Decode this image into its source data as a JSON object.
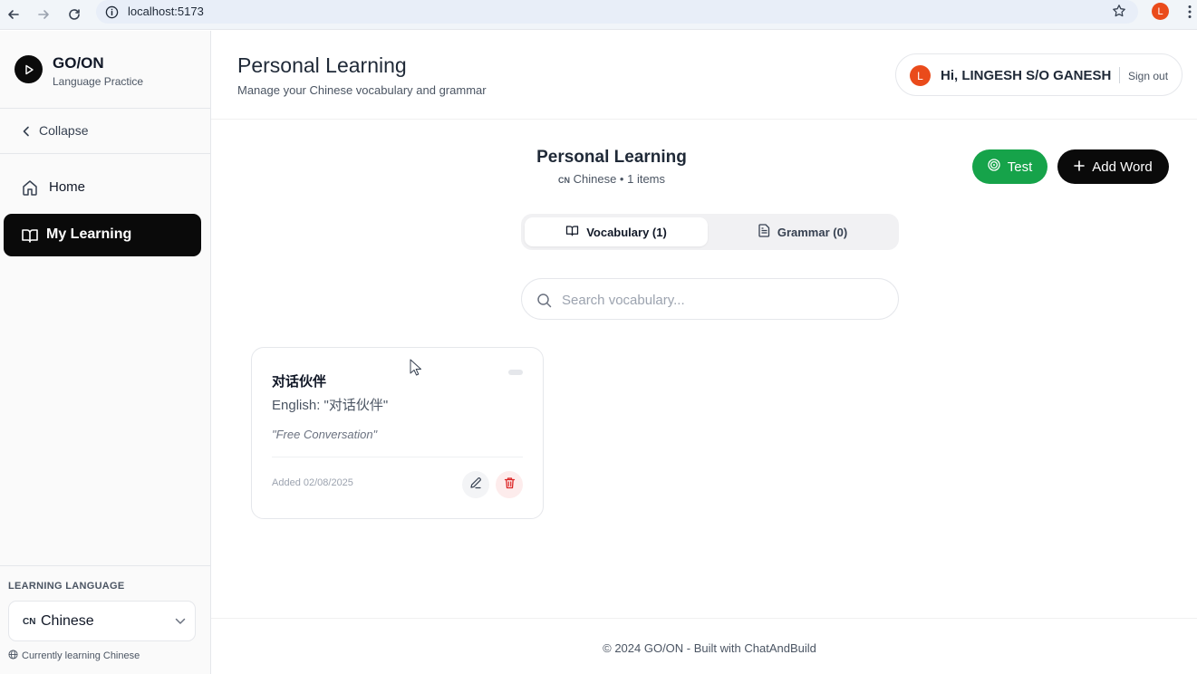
{
  "browser": {
    "url": "localhost:5173",
    "profile_initial": "L"
  },
  "brand": {
    "title": "GO/ON",
    "subtitle": "Language Practice"
  },
  "sidebar": {
    "collapse_label": "Collapse",
    "items": [
      {
        "label": "Home",
        "icon": "home-icon",
        "active": false
      },
      {
        "label": "My Learning",
        "icon": "book-open-icon",
        "active": true
      }
    ],
    "language_heading": "LEARNING LANGUAGE",
    "language_code": "CN",
    "language_name": "Chinese",
    "language_note": "Currently learning Chinese"
  },
  "header": {
    "title": "Personal Learning",
    "subtitle": "Manage your Chinese vocabulary and grammar",
    "user_initial": "L",
    "user_greeting": "Hi, LINGESH S/O GANESH",
    "signout_label": "Sign out"
  },
  "main": {
    "title": "Personal Learning",
    "meta_code": "CN",
    "meta_text": "Chinese • 1 items",
    "test_label": "Test",
    "add_label": "Add Word",
    "tabs": [
      {
        "label": "Vocabulary (1)",
        "active": true
      },
      {
        "label": "Grammar (0)",
        "active": false
      }
    ],
    "search": {
      "placeholder": "Search vocabulary...",
      "value": ""
    },
    "cards": [
      {
        "word": "对话伙伴",
        "english": "English: \"对话伙伴\"",
        "example": "\"Free Conversation\"",
        "added": "Added 02/08/2025"
      }
    ]
  },
  "footer": {
    "text": "© 2024 GO/ON - Built with ChatAndBuild"
  },
  "colors": {
    "accent_green": "#16a34a",
    "primary_black": "#0a0a0a",
    "avatar_orange": "#ea4b1b",
    "danger_red": "#dc2626"
  }
}
